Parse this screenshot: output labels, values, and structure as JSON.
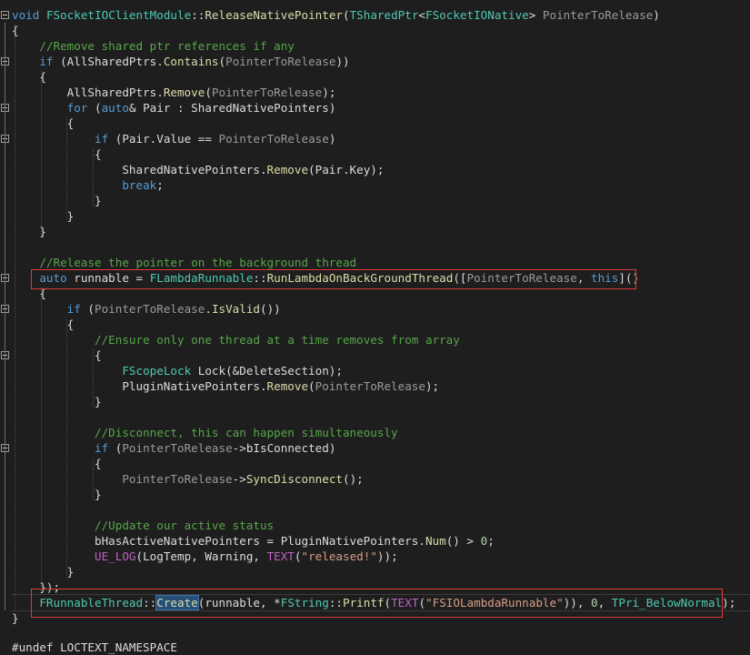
{
  "code": {
    "lines": [
      [
        [
          "kw",
          "void"
        ],
        [
          "tx",
          " "
        ],
        [
          "ty",
          "FSocketIOClientModule"
        ],
        [
          "tx",
          "::"
        ],
        [
          "fn",
          "ReleaseNativePointer"
        ],
        [
          "tx",
          "("
        ],
        [
          "ty",
          "TSharedPtr"
        ],
        [
          "tx",
          "<"
        ],
        [
          "ty",
          "FSocketIONative"
        ],
        [
          "tx",
          "> "
        ],
        [
          "pa",
          "PointerToRelease"
        ],
        [
          "tx",
          ")"
        ]
      ],
      [
        [
          "tx",
          "{"
        ]
      ],
      [
        [
          "tx",
          "    "
        ],
        [
          "cm",
          "//Remove shared ptr references if any"
        ]
      ],
      [
        [
          "tx",
          "    "
        ],
        [
          "kw",
          "if"
        ],
        [
          "tx",
          " (AllSharedPtrs."
        ],
        [
          "fn",
          "Contains"
        ],
        [
          "tx",
          "("
        ],
        [
          "pa",
          "PointerToRelease"
        ],
        [
          "tx",
          "))"
        ]
      ],
      [
        [
          "tx",
          "    {"
        ]
      ],
      [
        [
          "tx",
          "        AllSharedPtrs."
        ],
        [
          "fn",
          "Remove"
        ],
        [
          "tx",
          "("
        ],
        [
          "pa",
          "PointerToRelease"
        ],
        [
          "tx",
          ");"
        ]
      ],
      [
        [
          "tx",
          "        "
        ],
        [
          "kw",
          "for"
        ],
        [
          "tx",
          " ("
        ],
        [
          "kw",
          "auto"
        ],
        [
          "tx",
          "& Pair : SharedNativePointers)"
        ]
      ],
      [
        [
          "tx",
          "        {"
        ]
      ],
      [
        [
          "tx",
          "            "
        ],
        [
          "kw",
          "if"
        ],
        [
          "tx",
          " (Pair.Value == "
        ],
        [
          "pa",
          "PointerToRelease"
        ],
        [
          "tx",
          ")"
        ]
      ],
      [
        [
          "tx",
          "            {"
        ]
      ],
      [
        [
          "tx",
          "                SharedNativePointers."
        ],
        [
          "fn",
          "Remove"
        ],
        [
          "tx",
          "(Pair.Key);"
        ]
      ],
      [
        [
          "tx",
          "                "
        ],
        [
          "kw",
          "break"
        ],
        [
          "tx",
          ";"
        ]
      ],
      [
        [
          "tx",
          "            }"
        ]
      ],
      [
        [
          "tx",
          "        }"
        ]
      ],
      [
        [
          "tx",
          "    }"
        ]
      ],
      [
        [
          "tx",
          ""
        ]
      ],
      [
        [
          "tx",
          "    "
        ],
        [
          "cm",
          "//Release the pointer on the background thread"
        ]
      ],
      [
        [
          "tx",
          "    "
        ],
        [
          "kw",
          "auto"
        ],
        [
          "tx",
          " runnable = "
        ],
        [
          "ty",
          "FLambdaRunnable"
        ],
        [
          "tx",
          "::"
        ],
        [
          "fn",
          "RunLambdaOnBackGroundThread"
        ],
        [
          "tx",
          "(["
        ],
        [
          "pa",
          "PointerToRelease"
        ],
        [
          "tx",
          ", "
        ],
        [
          "kw",
          "this"
        ],
        [
          "tx",
          "]()"
        ]
      ],
      [
        [
          "tx",
          "    {"
        ]
      ],
      [
        [
          "tx",
          "        "
        ],
        [
          "kw",
          "if"
        ],
        [
          "tx",
          " ("
        ],
        [
          "pa",
          "PointerToRelease"
        ],
        [
          "tx",
          "."
        ],
        [
          "fn",
          "IsValid"
        ],
        [
          "tx",
          "())"
        ]
      ],
      [
        [
          "tx",
          "        {"
        ]
      ],
      [
        [
          "tx",
          "            "
        ],
        [
          "cm",
          "//Ensure only one thread at a time removes from array"
        ]
      ],
      [
        [
          "tx",
          "            {"
        ]
      ],
      [
        [
          "tx",
          "                "
        ],
        [
          "ty",
          "FScopeLock"
        ],
        [
          "tx",
          " Lock(&DeleteSection);"
        ]
      ],
      [
        [
          "tx",
          "                PluginNativePointers."
        ],
        [
          "fn",
          "Remove"
        ],
        [
          "tx",
          "("
        ],
        [
          "pa",
          "PointerToRelease"
        ],
        [
          "tx",
          ");"
        ]
      ],
      [
        [
          "tx",
          "            }"
        ]
      ],
      [
        [
          "tx",
          ""
        ]
      ],
      [
        [
          "tx",
          "            "
        ],
        [
          "cm",
          "//Disconnect, this can happen simultaneously"
        ]
      ],
      [
        [
          "tx",
          "            "
        ],
        [
          "kw",
          "if"
        ],
        [
          "tx",
          " ("
        ],
        [
          "pa",
          "PointerToRelease"
        ],
        [
          "tx",
          "->bIsConnected)"
        ]
      ],
      [
        [
          "tx",
          "            {"
        ]
      ],
      [
        [
          "tx",
          "                "
        ],
        [
          "pa",
          "PointerToRelease"
        ],
        [
          "tx",
          "->"
        ],
        [
          "fn",
          "SyncDisconnect"
        ],
        [
          "tx",
          "();"
        ]
      ],
      [
        [
          "tx",
          "            }"
        ]
      ],
      [
        [
          "tx",
          ""
        ]
      ],
      [
        [
          "tx",
          "            "
        ],
        [
          "cm",
          "//Update our active status"
        ]
      ],
      [
        [
          "tx",
          "            bHasActiveNativePointers = PluginNativePointers."
        ],
        [
          "fn",
          "Num"
        ],
        [
          "tx",
          "() > "
        ],
        [
          "nm",
          "0"
        ],
        [
          "tx",
          ";"
        ]
      ],
      [
        [
          "tx",
          "            "
        ],
        [
          "mc",
          "UE_LOG"
        ],
        [
          "tx",
          "(LogTemp, Warning, "
        ],
        [
          "mc",
          "TEXT"
        ],
        [
          "tx",
          "("
        ],
        [
          "st",
          "\"released!\""
        ],
        [
          "tx",
          "));"
        ]
      ],
      [
        [
          "tx",
          "        }"
        ]
      ],
      [
        [
          "tx",
          "    });"
        ]
      ],
      [
        [
          "tx",
          "    "
        ],
        [
          "ty",
          "FRunnableThread"
        ],
        [
          "tx",
          "::"
        ],
        [
          "fn",
          "Create"
        ],
        [
          "tx",
          "(runnable, *"
        ],
        [
          "ty",
          "FString"
        ],
        [
          "tx",
          "::"
        ],
        [
          "fn",
          "Printf"
        ],
        [
          "tx",
          "("
        ],
        [
          "mc",
          "TEXT"
        ],
        [
          "tx",
          "("
        ],
        [
          "st",
          "\"FSIOLambdaRunnable\""
        ],
        [
          "tx",
          ")), "
        ],
        [
          "nm",
          "0"
        ],
        [
          "tx",
          ", "
        ],
        [
          "ty",
          "TPri_BelowNormal"
        ],
        [
          "tx",
          ");"
        ]
      ],
      [
        [
          "tx",
          "}"
        ]
      ],
      [
        [
          "tx",
          ""
        ]
      ],
      [
        [
          "tx",
          "#undef LOCTEXT_NAMESPACE"
        ]
      ]
    ]
  },
  "colors": {
    "background": "#1e1e1e",
    "keyword": "#569cd6",
    "type": "#4ec9b0",
    "function": "#dcdcaa",
    "comment": "#57a64a",
    "string": "#d69d85",
    "parameter": "#9a9a9a",
    "macro": "#bd63c5",
    "annotation_box": "#e03a3a"
  },
  "icons": {
    "fold_marker": "minus-square-icon"
  }
}
